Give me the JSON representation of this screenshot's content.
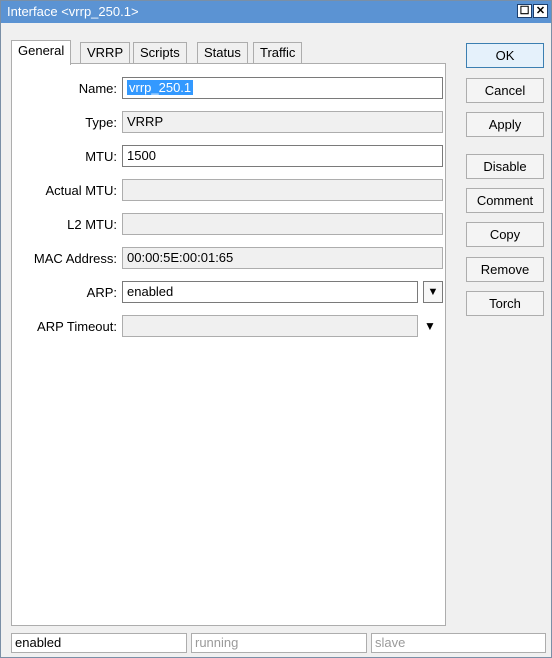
{
  "window": {
    "title": "Interface <vrrp_250.1>"
  },
  "tabs": [
    "General",
    "VRRP",
    "Scripts",
    "Status",
    "Traffic"
  ],
  "fields": {
    "name": {
      "label": "Name:",
      "value": "vrrp_250.1"
    },
    "type": {
      "label": "Type:",
      "value": "VRRP"
    },
    "mtu": {
      "label": "MTU:",
      "value": "1500"
    },
    "actual_mtu": {
      "label": "Actual MTU:",
      "value": ""
    },
    "l2_mtu": {
      "label": "L2 MTU:",
      "value": ""
    },
    "mac": {
      "label": "MAC Address:",
      "value": "00:00:5E:00:01:65"
    },
    "arp": {
      "label": "ARP:",
      "value": "enabled"
    },
    "arp_timeout": {
      "label": "ARP Timeout:",
      "value": ""
    }
  },
  "buttons": [
    "OK",
    "Cancel",
    "Apply",
    "Disable",
    "Comment",
    "Copy",
    "Remove",
    "Torch"
  ],
  "status": [
    "enabled",
    "running",
    "slave"
  ]
}
